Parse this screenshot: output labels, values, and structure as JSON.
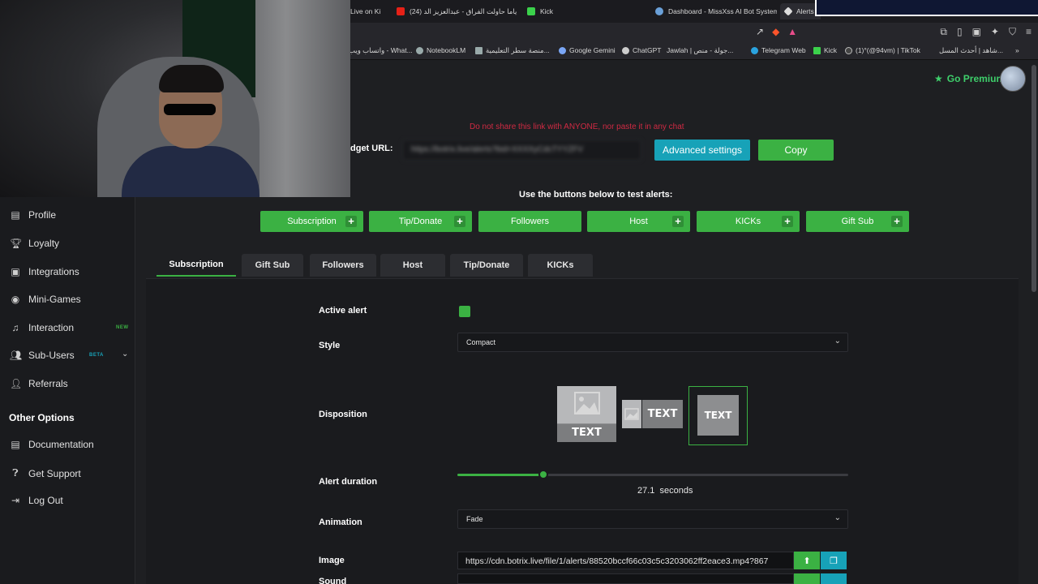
{
  "browser": {
    "tabs": [
      {
        "label": "Live on Ki"
      },
      {
        "label": "(24) ياما حاولت الفراق - عبدالعزيز الد"
      },
      {
        "label": "Kick"
      },
      {
        "label": "Dashboard - MissXss AI Bot System"
      },
      {
        "label": "Alerts",
        "active": true
      }
    ],
    "bookmarks": [
      {
        "label": "واتساب ويب - What..."
      },
      {
        "label": "NotebookLM"
      },
      {
        "label": "منصة سطر التعليمية..."
      },
      {
        "label": "Google Gemini"
      },
      {
        "label": "ChatGPT"
      },
      {
        "label": "Jawlah | جولة - منص..."
      },
      {
        "label": "Telegram Web"
      },
      {
        "label": "Kick"
      },
      {
        "label": "(1)‎°(@94vm) | TikTok"
      },
      {
        "label": "شاهد | أحدث المسل..."
      }
    ]
  },
  "header": {
    "premium_label": "Go Premium",
    "premium_icon": "star-icon"
  },
  "sidebar": {
    "items": [
      {
        "label": "Profile",
        "icon": "id-card-icon"
      },
      {
        "label": "Loyalty",
        "icon": "trophy-icon"
      },
      {
        "label": "Integrations",
        "icon": "integrations-icon"
      },
      {
        "label": "Mini-Games",
        "icon": "gamepad-icon"
      },
      {
        "label": "Interaction",
        "icon": "music-note-icon",
        "badge": "NEW"
      },
      {
        "label": "Sub-Users",
        "icon": "users-icon",
        "badge": "BETA"
      },
      {
        "label": "Referrals",
        "icon": "user-group-icon"
      }
    ],
    "other_heading": "Other Options",
    "other_items": [
      {
        "label": "Documentation",
        "icon": "document-icon"
      },
      {
        "label": "Get Support",
        "icon": "question-icon"
      },
      {
        "label": "Log Out",
        "icon": "logout-icon"
      }
    ]
  },
  "widget": {
    "warning": "Do not share this link with ANYONE, nor paste it in any chat",
    "url_label": "dget URL:",
    "url_value": "https://botrix.live/alerts?bid=XXXXyCdcTYYZFV",
    "advanced_label": "Advanced settings",
    "copy_label": "Copy"
  },
  "test": {
    "heading": "Use the buttons below to test alerts:",
    "buttons": [
      {
        "label": "Subscription",
        "plus": true
      },
      {
        "label": "Tip/Donate",
        "plus": true
      },
      {
        "label": "Followers",
        "plus": false
      },
      {
        "label": "Host",
        "plus": true
      },
      {
        "label": "KICKs",
        "plus": true
      },
      {
        "label": "Gift Sub",
        "plus": true
      }
    ]
  },
  "alert_tabs": [
    {
      "label": "Subscription",
      "active": true
    },
    {
      "label": "Gift Sub"
    },
    {
      "label": "Followers"
    },
    {
      "label": "Host"
    },
    {
      "label": "Tip/Donate"
    },
    {
      "label": "KICKs"
    }
  ],
  "settings": {
    "active_alert_label": "Active alert",
    "active_alert": true,
    "style_label": "Style",
    "style_value": "Compact",
    "disposition_label": "Disposition",
    "disposition_text": "TEXT",
    "disposition_selected": 3,
    "duration_label": "Alert duration",
    "duration_value": "27.1",
    "duration_unit": "seconds",
    "duration_fraction": 0.219,
    "animation_label": "Animation",
    "animation_value": "Fade",
    "image_label": "Image",
    "image_value": "https://cdn.botrix.live/file/1/alerts/88520bccf66c03c5c3203062ff2eace3.mp4?867",
    "sound_label": "Sound"
  },
  "colors": {
    "accent_green": "#3bb143",
    "accent_teal": "#17a2b8",
    "warning_red": "#d02a43"
  }
}
